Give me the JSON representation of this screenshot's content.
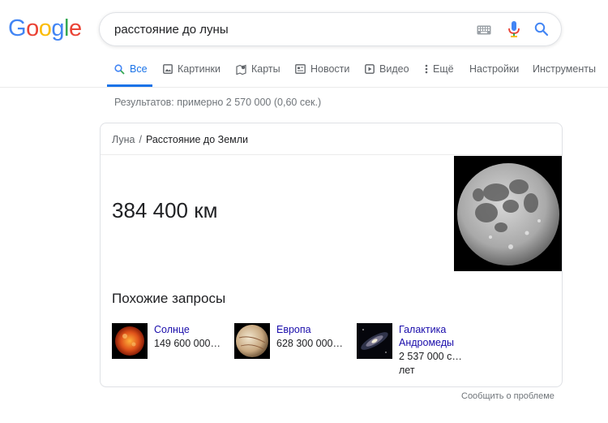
{
  "logo": {
    "letters": [
      "G",
      "o",
      "o",
      "g",
      "l",
      "e"
    ],
    "colors": [
      "#4285F4",
      "#EA4335",
      "#FBBC05",
      "#4285F4",
      "#34A853",
      "#EA4335"
    ]
  },
  "search": {
    "query": "расстояние до луны",
    "icons": [
      "keyboard-icon",
      "microphone-icon",
      "search-icon"
    ]
  },
  "tabs": [
    {
      "label": "Все",
      "icon": "search-icon",
      "active": true
    },
    {
      "label": "Картинки",
      "icon": "image-icon",
      "active": false
    },
    {
      "label": "Карты",
      "icon": "map-pin-icon",
      "active": false
    },
    {
      "label": "Новости",
      "icon": "news-icon",
      "active": false
    },
    {
      "label": "Видео",
      "icon": "play-icon",
      "active": false
    },
    {
      "label": "Ещё",
      "icon": "more-vert-icon",
      "active": false
    },
    {
      "label": "Настройки",
      "active": false
    },
    {
      "label": "Инструменты",
      "active": false
    }
  ],
  "results": {
    "count_text": "Результатов: примерно 2 570 000 (0,60 сек.)"
  },
  "knowledge_card": {
    "breadcrumb": {
      "entity": "Луна",
      "separator": "/",
      "attribute": "Расстояние до Земли"
    },
    "answer": "384 400 км",
    "image": "moon-photo",
    "related_title": "Похожие запросы",
    "related": [
      {
        "name": "Солнце",
        "value": "149 600 000…",
        "thumb": "sun-thumbnail"
      },
      {
        "name": "Европа",
        "value": "628 300 000…",
        "thumb": "europa-thumbnail"
      },
      {
        "name": "Галактика Андромеды",
        "value": "2 537 000 с… лет",
        "thumb": "andromeda-thumbnail"
      }
    ]
  },
  "footer": {
    "report_label": "Сообщить о проблеме"
  },
  "colors": {
    "accent": "#1a73e8",
    "link": "#1a0dab",
    "muted": "#70757a"
  }
}
